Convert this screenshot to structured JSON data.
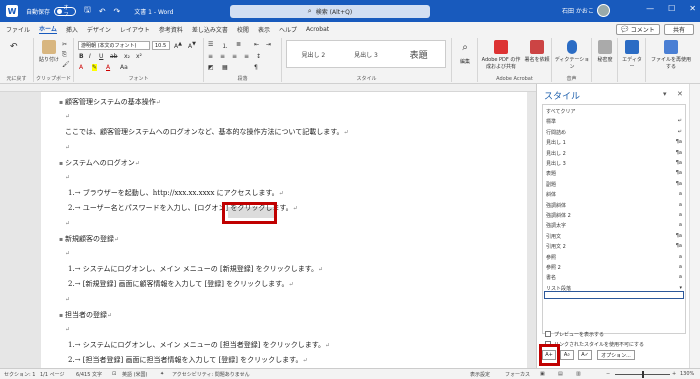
{
  "titlebar": {
    "app_letter": "W",
    "autosave_label": "自動保存",
    "autosave_state": "オフ",
    "doc_title": "文書 1 - Word",
    "search_placeholder": "検索 (Alt+Q)",
    "user_name": "石田 かおこ",
    "minimize": "—",
    "maximize": "☐",
    "close": "✕"
  },
  "menu": {
    "tabs": [
      "ファイル",
      "ホーム",
      "挿入",
      "デザイン",
      "レイアウト",
      "参考資料",
      "差し込み文書",
      "校閲",
      "表示",
      "ヘルプ",
      "Acrobat"
    ],
    "active_tab": "ホーム",
    "comment_label": "コメント",
    "share_label": "共有"
  },
  "ribbon": {
    "undo_label": "元に戻す",
    "paste_label": "貼り付け",
    "clipboard_label": "クリップボード",
    "font_name": "游明朝 (本文のフォント)",
    "font_size": "10.5",
    "font_label": "フォント",
    "paragraph_label": "段落",
    "style_label": "スタイル",
    "styles": [
      "見出し 2",
      "見出し 3",
      "表題"
    ],
    "edit_label": "編集",
    "acrobat_btn": "Adobe PDF の作成および共有",
    "sign_btn": "署名を依頼",
    "acrobat_group": "Adobe Acrobat",
    "dictation": "ディクテーション",
    "voice_group": "音声",
    "sensitivity": "秘密度",
    "editor": "エディター",
    "editor_group": "エディター",
    "reuse": "ファイルを再使用する",
    "reuse_group": "ファイルを再使用する"
  },
  "document": {
    "lines": [
      {
        "text": "顧客管理システムの基本操作",
        "kind": "heading"
      },
      {
        "text": "",
        "kind": "blank"
      },
      {
        "text": "ここでは、顧客管理システムへのログオンなど、基本的な操作方法について記載します。",
        "kind": "body"
      },
      {
        "text": "",
        "kind": "blank"
      },
      {
        "text": "システムへのログオン",
        "kind": "heading"
      },
      {
        "text": "",
        "kind": "blank"
      },
      {
        "text": "1.→ ブラウザーを起動し、http://xxx.xx.xxxx にアクセスします。",
        "kind": "list"
      },
      {
        "text": "2.→ ユーザー名とパスワードを入力し、[ログオン] をクリックします。",
        "kind": "list"
      },
      {
        "text": "",
        "kind": "blank"
      },
      {
        "text": "新規顧客の登録",
        "kind": "heading"
      },
      {
        "text": "",
        "kind": "blank"
      },
      {
        "text": "1.→ システムにログオンし、メイン メニューの [新規登録] をクリックします。",
        "kind": "list"
      },
      {
        "text": "2.→ [新規登録] 画面に顧客情報を入力して [登録] をクリックします。",
        "kind": "list"
      },
      {
        "text": "",
        "kind": "blank"
      },
      {
        "text": "担当者の登録",
        "kind": "heading"
      },
      {
        "text": "",
        "kind": "blank"
      },
      {
        "text": "1.→ システムにログオンし、メイン メニューの [担当者登録] をクリックします。",
        "kind": "list"
      },
      {
        "text": "2.→ [担当者登録] 画面に担当者情報を入力して [登録] をクリックします。",
        "kind": "list"
      }
    ],
    "paragraph_mark": "↵"
  },
  "styles_pane": {
    "title": "スタイル",
    "items": [
      {
        "name": "すべてクリア",
        "icon": ""
      },
      {
        "name": "標準",
        "icon": "↵"
      },
      {
        "name": "行間詰め",
        "icon": "↵"
      },
      {
        "name": "見出し 1",
        "icon": "¶a"
      },
      {
        "name": "見出し 2",
        "icon": "¶a"
      },
      {
        "name": "見出し 3",
        "icon": "¶a"
      },
      {
        "name": "表題",
        "icon": "¶a"
      },
      {
        "name": "副題",
        "icon": "¶a"
      },
      {
        "name": "斜体",
        "icon": "a"
      },
      {
        "name": "強調斜体",
        "icon": "a"
      },
      {
        "name": "強調斜体 2",
        "icon": "a"
      },
      {
        "name": "強調太字",
        "icon": "a"
      },
      {
        "name": "引用文",
        "icon": "¶a"
      },
      {
        "name": "引用文 2",
        "icon": "¶a"
      },
      {
        "name": "参照",
        "icon": "a"
      },
      {
        "name": "参照 2",
        "icon": "a"
      },
      {
        "name": "書名",
        "icon": "a"
      },
      {
        "name": "リスト段落",
        "icon": "▾"
      }
    ],
    "selected": "リスト段落",
    "preview_label": "プレビューを表示する",
    "linked_label": "リンクされたスタイルを使用不可にする",
    "options_label": "オプション..."
  },
  "statusbar": {
    "section": "セクション: 1",
    "page": "1/1 ページ",
    "words": "6/415 文字",
    "lang": "英語 (米国)",
    "accessibility": "アクセシビリティ: 問題ありません",
    "display_settings": "表示設定",
    "focus": "フォーカス",
    "zoom": "130%"
  },
  "colors": {
    "title_bar": "#185abd",
    "highlight": "#c00000"
  }
}
